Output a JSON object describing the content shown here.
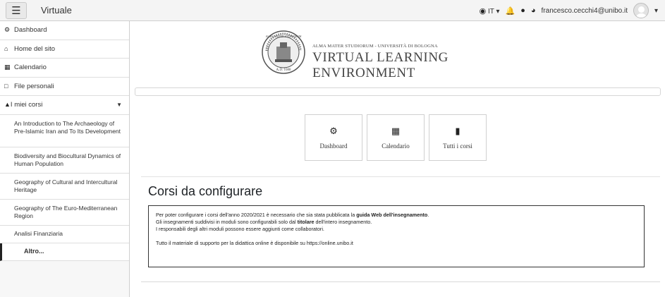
{
  "topbar": {
    "menu_icon": "hamburger-icon",
    "brand": "Virtuale",
    "language": "IT",
    "user_email": "francesco.cecchi4@unibo.it"
  },
  "sidebar": {
    "items": [
      {
        "label": "Dashboard",
        "icon": "dashboard-icon"
      },
      {
        "label": "Home del sito",
        "icon": "home-icon"
      },
      {
        "label": "Calendario",
        "icon": "calendar-icon"
      },
      {
        "label": "File personali",
        "icon": "file-icon"
      }
    ],
    "group": {
      "label": "I miei corsi",
      "icon": "graduation-cap-icon"
    },
    "courses": [
      "An Introduction to The Archaeology of Pre-Islamic Iran and To Its Development",
      "Biodiversity and Biocultural Dynamics of Human Population",
      "Geography of Cultural and Intercultural Heritage",
      "Geography of The Euro-Mediterranean Region",
      "Analisi Finanziaria"
    ],
    "altro": "Altro..."
  },
  "logo": {
    "seal_text": "ALMA MATER STUDIORUM",
    "seal_year": "A.D. 1088",
    "subtitle": "ALMA MATER STUDIORUM - UNIVERSITÀ DI BOLOGNA",
    "title": "VIRTUAL LEARNING ENVIRONMENT"
  },
  "tiles": [
    {
      "label": "Dashboard",
      "icon": "dashboard-icon"
    },
    {
      "label": "Calendario",
      "icon": "calendar-icon"
    },
    {
      "label": "Tutti i corsi",
      "icon": "book-icon"
    }
  ],
  "section": {
    "title": "Corsi da configurare",
    "line1_pre": "Per poter configurare i corsi dell'anno 2020/2021 è necessario che sia stata pubblicata la ",
    "line1_bold": "guida Web dell'insegnamento",
    "line1_post": ".",
    "line2_pre": "Gli insegnamenti suddivisi in moduli sono configurabili solo dal ",
    "line2_bold": "titolare",
    "line2_post": " dell'intero insegnamento.",
    "line3": "I responsabili degli altri moduli possono essere aggiunti come collaboratori.",
    "line4": "Tutto il materiale di supporto per la didattica online è disponibile su https://online.unibo.it"
  }
}
